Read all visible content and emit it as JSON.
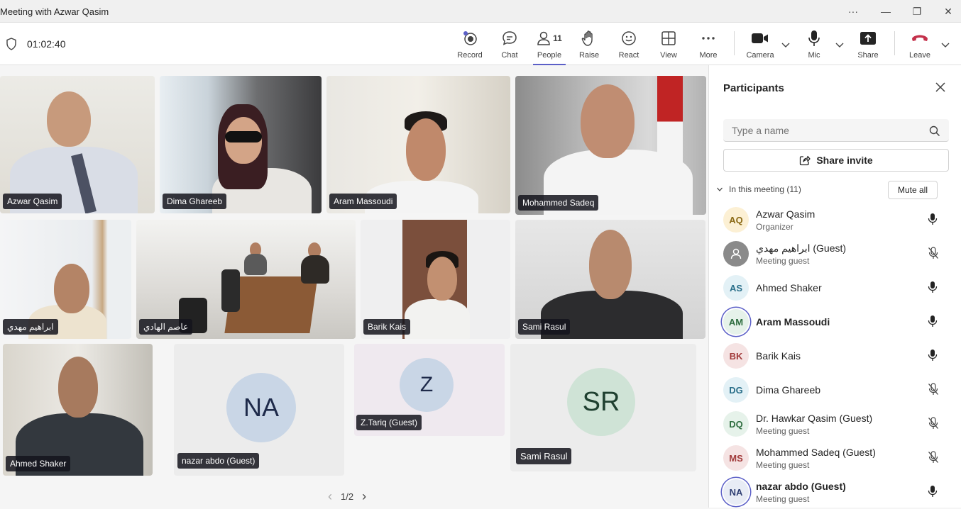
{
  "window": {
    "title": "Meeting with Azwar Qasim",
    "more": "···",
    "minimize": "—",
    "restore": "❐",
    "close": "✕"
  },
  "toolbar": {
    "timer": "01:02:40",
    "record": "Record",
    "chat": "Chat",
    "people": "People",
    "people_count": "11",
    "raise": "Raise",
    "react": "React",
    "view": "View",
    "more": "More",
    "camera": "Camera",
    "mic": "Mic",
    "share": "Share",
    "leave": "Leave",
    "accent": "#5b5fc7",
    "leave_color": "#c4314b"
  },
  "tiles": [
    {
      "name": "Azwar Qasim"
    },
    {
      "name": "Dima Ghareeb"
    },
    {
      "name": "Aram Massoudi"
    },
    {
      "name": "Mohammed Sadeq"
    },
    {
      "name": "ابراهيم مهدي"
    },
    {
      "name": "عاصم الهادي"
    },
    {
      "name": "Barik Kais"
    },
    {
      "name": "Sami Rasul"
    },
    {
      "name": "Ahmed Shaker"
    },
    {
      "name": "nazar abdo (Guest)",
      "initials": "NA"
    },
    {
      "name": "Z.Tariq (Guest)",
      "initials": "Z"
    },
    {
      "name": "Sami Rasul",
      "initials": "SR"
    }
  ],
  "pager": {
    "label": "1/2",
    "prev": "‹",
    "next": "›"
  },
  "panel": {
    "title": "Participants",
    "search_placeholder": "Type a name",
    "share_invite": "Share invite",
    "section": "In this meeting (11)",
    "mute_all": "Mute all",
    "participants": [
      {
        "initials": "AQ",
        "name": "Azwar Qasim",
        "sub": "Organizer",
        "mic": "on",
        "bg": "#fcf0d4",
        "fg": "#8a6914"
      },
      {
        "initials": "",
        "name": "ابراهيم مهدي (Guest)",
        "sub": "Meeting guest",
        "mic": "off",
        "bg": "#8a8a8a",
        "fg": "#ffffff"
      },
      {
        "initials": "AS",
        "name": "Ahmed Shaker",
        "sub": "",
        "mic": "on",
        "bg": "#e3f1f6",
        "fg": "#2a6f8a"
      },
      {
        "initials": "AM",
        "name": "Aram Massoudi",
        "sub": "",
        "mic": "on",
        "bg": "#e6f2ea",
        "fg": "#2f6e40"
      },
      {
        "initials": "BK",
        "name": "Barik Kais",
        "sub": "",
        "mic": "on",
        "bg": "#f5e3e3",
        "fg": "#a13a3a"
      },
      {
        "initials": "DG",
        "name": "Dima Ghareeb",
        "sub": "",
        "mic": "off",
        "bg": "#e3f1f6",
        "fg": "#2a6f8a"
      },
      {
        "initials": "DQ",
        "name": "Dr. Hawkar Qasim (Guest)",
        "sub": "Meeting guest",
        "mic": "off",
        "bg": "#e6f2ea",
        "fg": "#2f6e40"
      },
      {
        "initials": "MS",
        "name": "Mohammed Sadeq (Guest)",
        "sub": "Meeting guest",
        "mic": "off",
        "bg": "#f5e3e3",
        "fg": "#a13a3a"
      },
      {
        "initials": "NA",
        "name": "nazar abdo (Guest)",
        "sub": "Meeting guest",
        "mic": "on",
        "bg": "#e8ecf5",
        "fg": "#2f3f73"
      }
    ]
  }
}
